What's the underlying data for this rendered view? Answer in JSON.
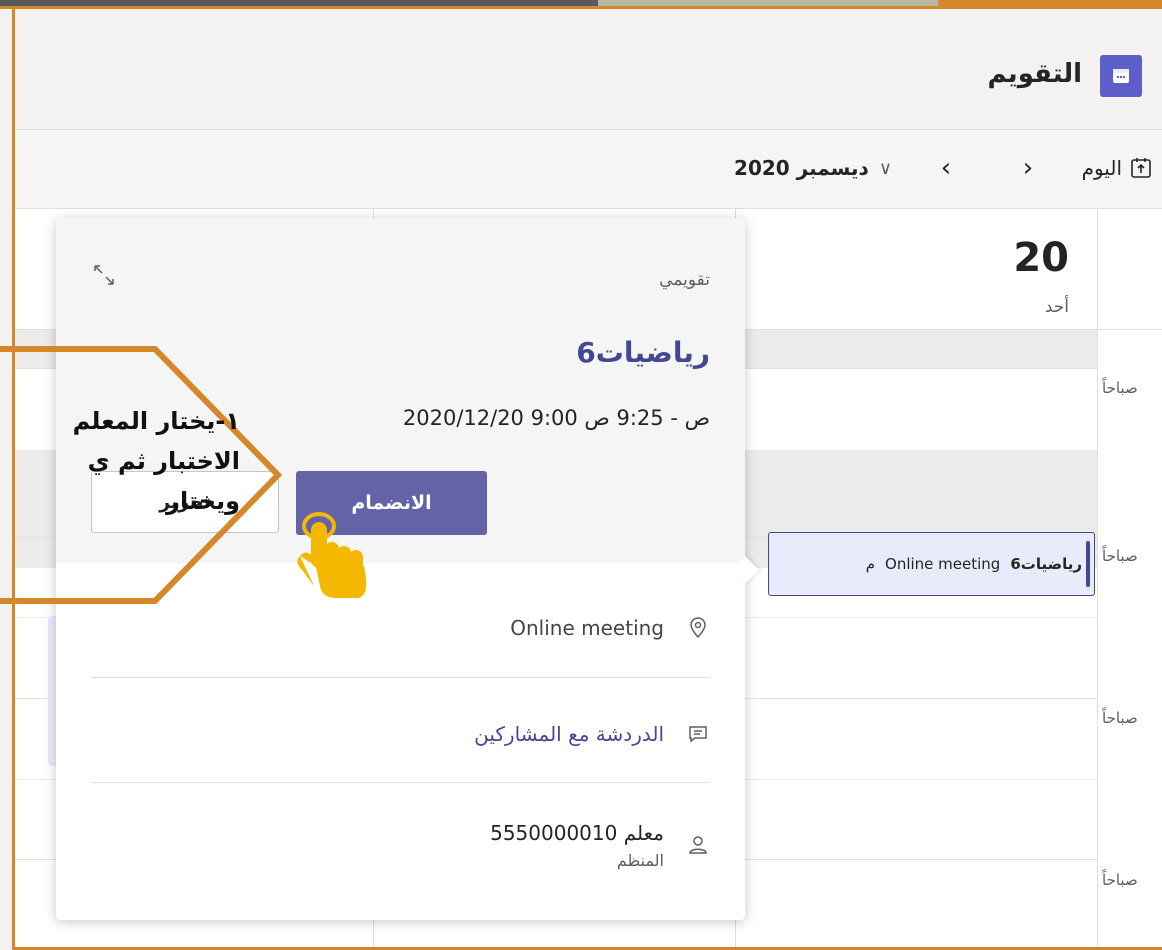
{
  "header": {
    "title": "التقويم",
    "icon": "calendar-icon"
  },
  "toolbar": {
    "today_label": "اليوم",
    "month_label": "ديسمبر 2020",
    "prev_icon": "chevron-left-icon",
    "next_icon": "chevron-right-icon",
    "month_chevron": "chevron-down-icon"
  },
  "day": {
    "number": "20",
    "name": "أحد"
  },
  "time_labels": [
    "صباحاً",
    "صباحاً",
    "صباحاً",
    "صباحاً"
  ],
  "event": {
    "title": "رياضيات6",
    "location": "Online meeting",
    "more": "م"
  },
  "popup": {
    "calendar_name": "تقويمي",
    "meeting_title": "رياضيات6",
    "time": "2020/12/20 9:00 ص - 9:25 ص",
    "join_label": "الانضمام",
    "edit_label": "تحرير",
    "location": "Online meeting",
    "chat_label": "الدردشة مع المشاركين",
    "organizer_name": "معلم 5550000010",
    "organizer_role": "المنظم"
  },
  "callout": {
    "line1": "١-يختار المعلم",
    "line2": "الاختبار ثم ي",
    "line3": "ويختار"
  },
  "colors": {
    "accent": "#6264a7",
    "brand": "#5b5fc7",
    "frame": "#d4882a",
    "hand": "#f5b800"
  }
}
